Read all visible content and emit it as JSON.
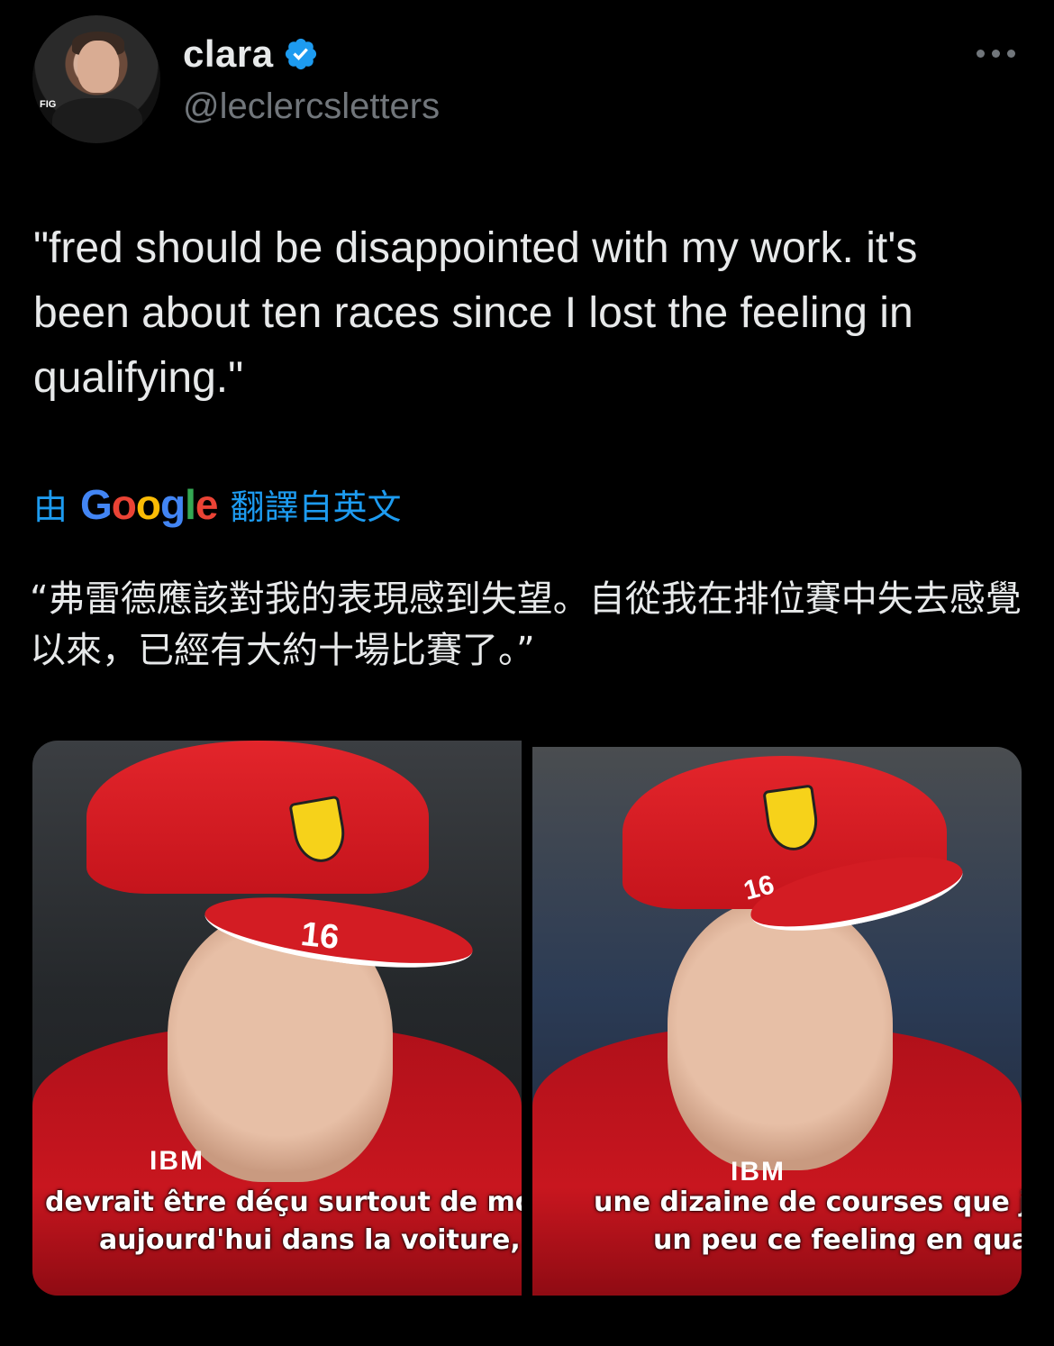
{
  "author": {
    "name": "clara",
    "handle": "@leclercsletters",
    "verified": true,
    "avatar_badge_text": "FIG"
  },
  "tweet": {
    "text": "\"fred should be disappointed with my work. it's been about ten races since I lost the feeling in qualifying.\"",
    "translation_by": "由",
    "translation_provider": "Google",
    "translation_label": "翻譯自英文",
    "translated_text": "“弗雷德應該對我的表現感到失望。自從我在排位賽中失去感覺以來，已經有大約十場比賽了。”"
  },
  "media": [
    {
      "subtitle_line1": "devrait être déçu surtout de mor",
      "subtitle_line2": "aujourd'hui dans la voiture,",
      "cap_number": "16",
      "chest_logo": "IBM"
    },
    {
      "subtitle_line1": "une dizaine de courses que j",
      "subtitle_line2": "un peu ce feeling en qua",
      "cap_number": "16",
      "chest_logo": "IBM"
    }
  ],
  "colors": {
    "background": "#000000",
    "text": "#e7e9ea",
    "secondary": "#71767b",
    "link": "#1d9bf0",
    "verified": "#1d9bf0"
  }
}
